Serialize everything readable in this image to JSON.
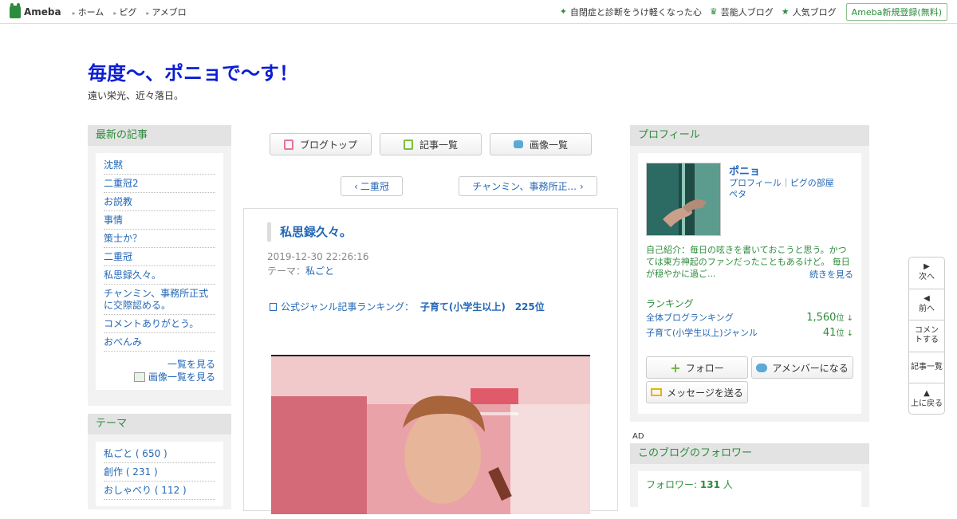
{
  "topbar": {
    "logo": "Ameba",
    "nav": [
      "ホーム",
      "ピグ",
      "アメブロ"
    ],
    "right_links": [
      {
        "label": "自閉症と診断をうけ軽くなった心",
        "icon": "sparkle-icon"
      },
      {
        "label": "芸能人ブログ",
        "icon": "crown-icon"
      },
      {
        "label": "人気ブログ",
        "icon": "star-icon"
      }
    ],
    "signup": "Ameba新規登録(無料)"
  },
  "header": {
    "title": "毎度～、ポニョで～す！",
    "description": "遠い栄光、近々落日。"
  },
  "recent": {
    "heading": "最新の記事",
    "items": [
      "沈黙",
      "二重冠2",
      "お説教",
      "事情",
      "策士か？",
      "二重冠",
      "私思録久々。",
      "チャンミン、事務所正式に交際認める。",
      "コメントありがとう。",
      "おべんみ"
    ],
    "more": "一覧を見る",
    "images_more": "画像一覧を見る"
  },
  "themes": {
    "heading": "テーマ",
    "items": [
      "私ごと ( 650 )",
      "創作 ( 231 )",
      "おしゃべり ( 112 )"
    ]
  },
  "center": {
    "buttons": [
      "ブログトップ",
      "記事一覧",
      "画像一覧"
    ],
    "prev": "二重冠",
    "next": "チャンミン、事務所正..."
  },
  "article": {
    "title": "私思録久々。",
    "date": "2019-12-30 22:26:16",
    "theme_label": "テーマ：",
    "theme": "私ごと",
    "ranking_label": "公式ジャンル記事ランキング：",
    "ranking_genre": "子育て(小学生以上)",
    "ranking_rank": "225位"
  },
  "profile": {
    "heading": "プロフィール",
    "name": "ポニョ",
    "links": "プロフィール｜ピグの部屋",
    "link2": "ペタ",
    "intro": "自己紹介：毎日の呟きを書いておこうと思う。かつては東方神起のファンだったこともあるけど。 毎日が穏やかに過ご...",
    "more": "続きを見る",
    "ranking_heading": "ランキング",
    "rankings": [
      {
        "label": "全体ブログランキング",
        "value": "1,560",
        "unit": "位 ↓"
      },
      {
        "label": "子育て(小学生以上)ジャンル",
        "value": "41",
        "unit": "位 ↓"
      }
    ],
    "follow": "フォロー",
    "amember": "アメンバーになる",
    "message": "メッセージを送る"
  },
  "ad": "AD",
  "followers": {
    "heading": "このブログのフォロワー",
    "label": "フォロワー:",
    "count": "131",
    "unit": "人"
  },
  "floatnav": [
    "次へ",
    "前へ",
    "コメントする",
    "記事一覧",
    "上に戻る"
  ]
}
